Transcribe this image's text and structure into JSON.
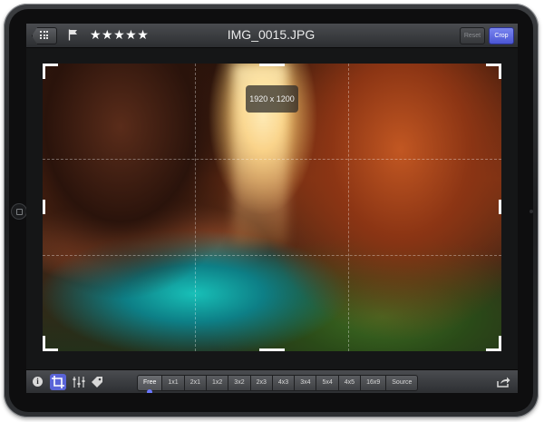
{
  "top_toolbar": {
    "title": "IMG_0015.JPG",
    "rating_stars": "★★★★★",
    "rating": 5,
    "reset_label": "Reset",
    "crop_label": "Crop",
    "icons": {
      "back": "grid-icon",
      "flag": "flag-icon"
    }
  },
  "photo": {
    "size_label": "1920 x 1200"
  },
  "bottom_toolbar": {
    "icons": [
      "info-icon",
      "crop-icon",
      "sliders-icon",
      "tag-icon",
      "share-icon"
    ],
    "info_glyph": "i",
    "aspect_ratios": [
      "Free",
      "1x1",
      "2x1",
      "1x2",
      "3x2",
      "2x3",
      "4x3",
      "3x4",
      "5x4",
      "4x5",
      "16x9",
      "Source"
    ],
    "selected_ratio": "Free"
  },
  "colors": {
    "accent": "#5a64d8",
    "crop_button": "#4b56d4",
    "toolbar": "#3a3c3f"
  }
}
